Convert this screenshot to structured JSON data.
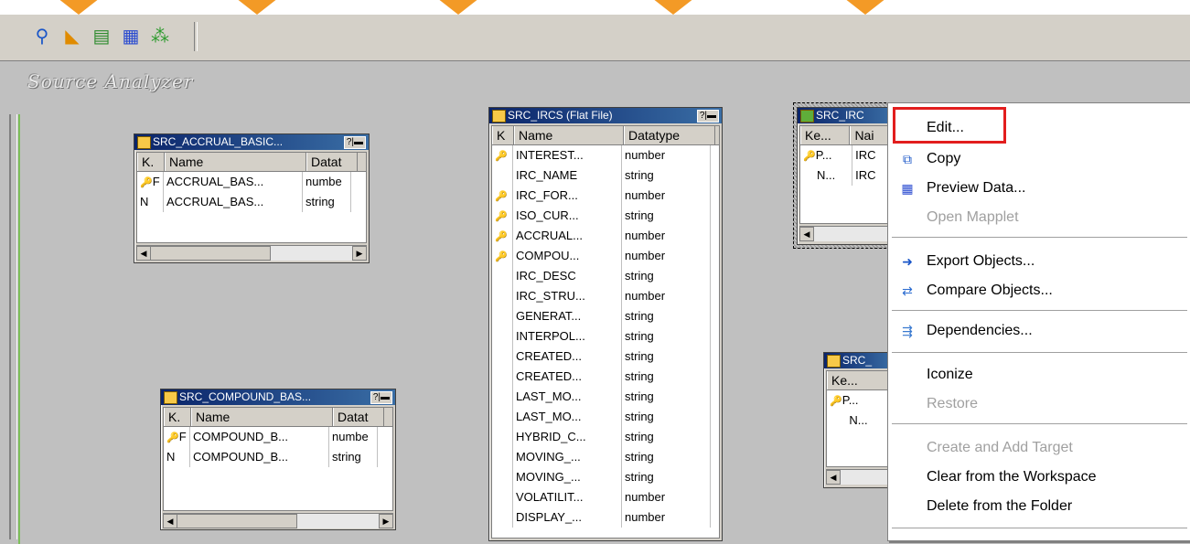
{
  "toolbar": {
    "buttons": [
      {
        "name": "source-analyzer-icon",
        "glyph": "⚲",
        "color": "#1a56c8"
      },
      {
        "name": "target-designer-icon",
        "glyph": "◣",
        "color": "#e08b00"
      },
      {
        "name": "transformation-developer-icon",
        "glyph": "▤",
        "color": "#2e8b2e"
      },
      {
        "name": "mapplet-designer-icon",
        "glyph": "▦",
        "color": "#2a4bd0"
      },
      {
        "name": "mapping-designer-icon",
        "glyph": "⁂",
        "color": "#2e9b2e"
      }
    ]
  },
  "workspace": {
    "title": "Source Analyzer"
  },
  "tables": {
    "accrual": {
      "title": "SRC_ACCRUAL_BASIC...",
      "headers": [
        "K.",
        "Name",
        "Datat"
      ],
      "rows": [
        {
          "k": "F",
          "name": "ACCRUAL_BAS...",
          "type": "numbe"
        },
        {
          "k": "N",
          "name": "ACCRUAL_BAS...",
          "type": "string"
        }
      ]
    },
    "compound": {
      "title": "SRC_COMPOUND_BAS...",
      "headers": [
        "K.",
        "Name",
        "Datat"
      ],
      "rows": [
        {
          "k": "F",
          "name": "COMPOUND_B...",
          "type": "numbe"
        },
        {
          "k": "N",
          "name": "COMPOUND_B...",
          "type": "string"
        }
      ]
    },
    "ircs": {
      "title": "SRC_IRCS (Flat File)",
      "headers": [
        "K",
        "Name",
        "Datatype"
      ],
      "rows": [
        {
          "name": "INTEREST...",
          "type": "number"
        },
        {
          "name": "IRC_NAME",
          "type": "string"
        },
        {
          "name": "IRC_FOR...",
          "type": "number"
        },
        {
          "name": "ISO_CUR...",
          "type": "string"
        },
        {
          "name": "ACCRUAL...",
          "type": "number"
        },
        {
          "name": "COMPOU...",
          "type": "number"
        },
        {
          "name": "IRC_DESC",
          "type": "string"
        },
        {
          "name": "IRC_STRU...",
          "type": "number"
        },
        {
          "name": "GENERAT...",
          "type": "string"
        },
        {
          "name": "INTERPOL...",
          "type": "string"
        },
        {
          "name": "CREATED...",
          "type": "string"
        },
        {
          "name": "CREATED...",
          "type": "string"
        },
        {
          "name": "LAST_MO...",
          "type": "string"
        },
        {
          "name": "LAST_MO...",
          "type": "string"
        },
        {
          "name": "HYBRID_C...",
          "type": "string"
        },
        {
          "name": "MOVING_...",
          "type": "string"
        },
        {
          "name": "MOVING_...",
          "type": "string"
        },
        {
          "name": "VOLATILIT...",
          "type": "number"
        },
        {
          "name": "DISPLAY_...",
          "type": "number"
        }
      ]
    },
    "irc_selected": {
      "title": "SRC_IRC",
      "headers": [
        "Ke...",
        "Nai"
      ],
      "rows": [
        {
          "k": "P...",
          "name": "IRC"
        },
        {
          "k": "N...",
          "name": "IRC"
        }
      ]
    },
    "src_lower": {
      "title": "SRC_",
      "headers": [
        "Ke..."
      ],
      "rows": [
        {
          "k": "P..."
        },
        {
          "k": "N..."
        }
      ]
    }
  },
  "context_menu": {
    "items": {
      "edit": "Edit...",
      "copy": "Copy",
      "preview": "Preview Data...",
      "open_mapplet": "Open Mapplet",
      "export": "Export Objects...",
      "compare": "Compare Objects...",
      "dependencies": "Dependencies...",
      "iconize": "Iconize",
      "restore": "Restore",
      "create_target": "Create and Add Target",
      "clear": "Clear from the Workspace",
      "delete": "Delete from the Folder"
    }
  },
  "colors": {
    "highlight": "#e21e1e",
    "title_bar": "#0a246a",
    "workspace": "#c0c0c0",
    "banner": "#f39a26"
  }
}
